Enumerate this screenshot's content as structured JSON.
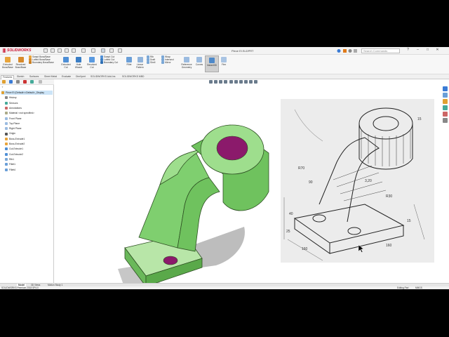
{
  "app": {
    "brand": "SOLIDWORKS",
    "doc_title": "Piece El.SLDPRT",
    "search_placeholder": "Search Commands",
    "window_controls": [
      "?",
      "–",
      "□",
      "✕"
    ]
  },
  "ribbon": {
    "big_buttons": [
      {
        "label1": "Extruded",
        "label2": "Boss/Base",
        "icon": "extruded-boss-icon"
      },
      {
        "label1": "Revolved",
        "label2": "Boss/Base",
        "icon": "revolved-boss-icon"
      },
      {
        "label1": "Extruded",
        "label2": "Cut",
        "icon": "extruded-cut-icon"
      },
      {
        "label1": "Hole",
        "label2": "Wizard",
        "icon": "hole-wizard-icon"
      },
      {
        "label1": "Revolved",
        "label2": "Cut",
        "icon": "revolved-cut-icon"
      },
      {
        "label1": "Fillet",
        "label2": "",
        "icon": "fillet-icon"
      },
      {
        "label1": "Linear",
        "label2": "Pattern",
        "icon": "linear-pattern-icon"
      },
      {
        "label1": "Reference",
        "label2": "Geometry",
        "icon": "reference-geometry-icon"
      },
      {
        "label1": "Curves",
        "label2": "",
        "icon": "curves-icon"
      },
      {
        "label1": "Instant3D",
        "label2": "",
        "icon": "instant3d-icon"
      },
      {
        "label1": "Flex",
        "label2": "",
        "icon": "flex-icon"
      }
    ],
    "small_col1": [
      "Swept Boss/Base",
      "Lofted Boss/Base",
      "Boundary Boss/Base"
    ],
    "small_col2": [
      "Swept Cut",
      "Lofted Cut",
      "Boundary Cut"
    ],
    "small_col3": [
      "Rib",
      "Draft",
      "Shell"
    ],
    "small_col4": [
      "Wrap",
      "Intersect",
      "Mirror"
    ]
  },
  "tabs": [
    "Features",
    "Sketch",
    "Surfaces",
    "Sheet Metal",
    "Evaluate",
    "DimXpert",
    "SOLIDWORKS Add-Ins",
    "SOLIDWORKS MBD"
  ],
  "feature_tree": {
    "filter_hint": "▼",
    "items": [
      {
        "label": "Piece El (Default<<Default>_Display",
        "icon": "part-icon",
        "level": 0,
        "selected": true
      },
      {
        "label": "History",
        "icon": "history-icon",
        "level": 1
      },
      {
        "label": "Sensors",
        "icon": "sensors-icon",
        "level": 1
      },
      {
        "label": "Annotations",
        "icon": "annotations-icon",
        "level": 1
      },
      {
        "label": "Material <not specified>",
        "icon": "material-icon",
        "level": 1
      },
      {
        "label": "Front Plane",
        "icon": "plane-icon",
        "level": 1
      },
      {
        "label": "Top Plane",
        "icon": "plane-icon",
        "level": 1
      },
      {
        "label": "Right Plane",
        "icon": "plane-icon",
        "level": 1
      },
      {
        "label": "Origin",
        "icon": "origin-icon",
        "level": 1
      },
      {
        "label": "Boss-Extrude1",
        "icon": "boss-extrude-icon",
        "level": 1
      },
      {
        "label": "Boss-Extrude2",
        "icon": "boss-extrude-icon",
        "level": 1
      },
      {
        "label": "Cut-Extrude1",
        "icon": "cut-extrude-icon",
        "level": 1
      },
      {
        "label": "Cut-Extrude2",
        "icon": "cut-extrude-icon",
        "level": 1
      },
      {
        "label": "Rib1",
        "icon": "rib-icon",
        "level": 1
      },
      {
        "label": "Fillet1",
        "icon": "fillet-icon",
        "level": 1
      },
      {
        "label": "Fillet4",
        "icon": "fillet-icon",
        "level": 1
      }
    ]
  },
  "bottom_tabs": [
    "Model",
    "3D Views",
    "Motion Study 1"
  ],
  "status": {
    "left": "SOLIDWORKS Premium 2018 SP4.0",
    "editing": "Editing Part",
    "units": "MMGS"
  },
  "drawing_dimensions": [
    "15",
    "3,20",
    "R30",
    "90",
    "R70",
    "40",
    "25",
    "160",
    "160",
    "15"
  ],
  "colors": {
    "part_green": "#7fcf6f",
    "hole_magenta": "#8b1a6b",
    "selection_blue": "#cce4f7",
    "brand_red": "#c8102e"
  }
}
